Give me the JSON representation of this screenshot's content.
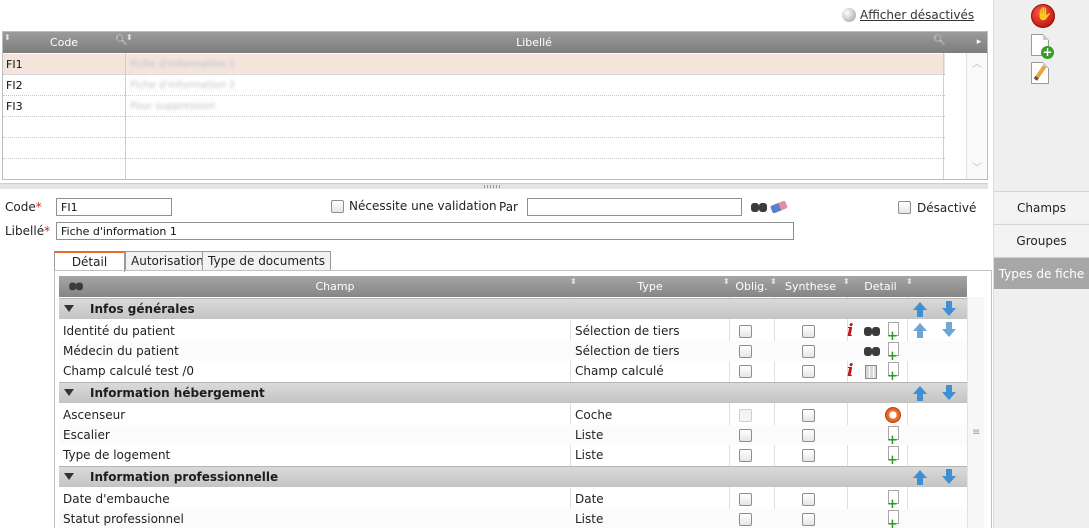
{
  "toolbar": {
    "show_disabled_label": "Afficher désactivés"
  },
  "list": {
    "columns": {
      "code": "Code",
      "libelle": "Libellé"
    },
    "rows": [
      {
        "code": "FI1",
        "libelle": "Fiche d'information 1"
      },
      {
        "code": "FI2",
        "libelle": "Fiche d'information 2"
      },
      {
        "code": "FI3",
        "libelle": "Pour suppression"
      }
    ]
  },
  "sidebar": {
    "tabs": {
      "champs": "Champs",
      "groupes": "Groupes",
      "types": "Types de fiche"
    },
    "active_tab": "Types de fiche"
  },
  "form": {
    "code_label": "Code",
    "code_value": "FI1",
    "libelle_label": "Libellé",
    "libelle_value": "Fiche d'information 1",
    "required_mark": "*",
    "validation_label": "Nécessite une validation",
    "par_label": "Par",
    "par_value": "",
    "desactive_label": "Désactivé"
  },
  "tabs": {
    "detail": "Détail",
    "autorisation": "Autorisation",
    "type_documents": "Type de documents"
  },
  "grid": {
    "columns": {
      "champ": "Champ",
      "type": "Type",
      "oblig": "Oblig.",
      "synthese": "Synthese",
      "detail": "Detail"
    },
    "groups": [
      {
        "title": "Infos générales",
        "rows": [
          {
            "champ": "Identité du patient",
            "type": "Sélection de tiers"
          },
          {
            "champ": "Médecin du patient",
            "type": "Sélection de tiers"
          },
          {
            "champ": "Champ calculé test /0",
            "type": "Champ calculé"
          }
        ]
      },
      {
        "title": "Information hébergement",
        "rows": [
          {
            "champ": "Ascenseur",
            "type": "Coche"
          },
          {
            "champ": "Escalier",
            "type": "Liste"
          },
          {
            "champ": "Type de logement",
            "type": "Liste"
          }
        ]
      },
      {
        "title": "Information professionnelle",
        "rows": [
          {
            "champ": "Date d'embauche",
            "type": "Date"
          },
          {
            "champ": "Statut professionnel",
            "type": "Liste"
          }
        ]
      }
    ]
  },
  "colors": {
    "accent_tab": "#e56a2b",
    "selected_row": "#f3e5dc",
    "arrow": "#3f8fd2",
    "required": "#d01c1c"
  }
}
